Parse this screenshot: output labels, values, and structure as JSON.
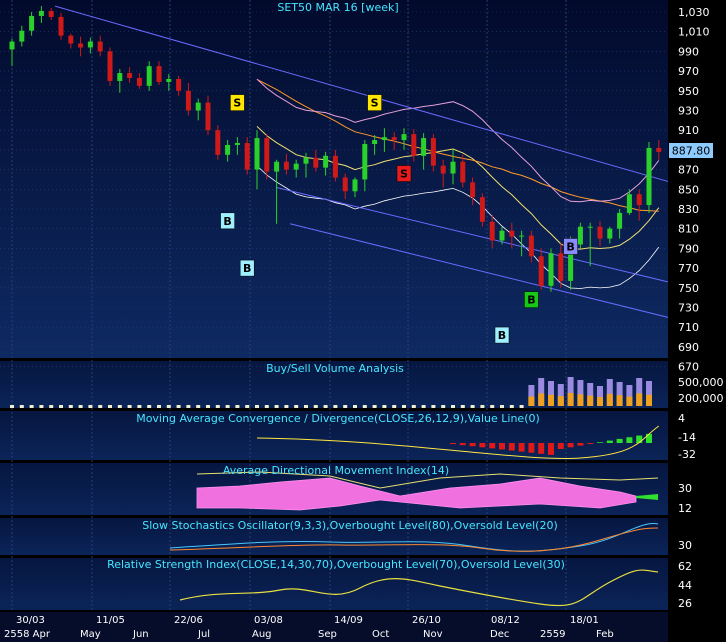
{
  "chart_data": [
    {
      "type": "candlestick",
      "title": "SET50 MAR 16",
      "interval": "[week]",
      "last_price_tag": "887.80",
      "y_ticks": [
        "1,030",
        "1,010",
        "990",
        "970",
        "950",
        "930",
        "910",
        "890",
        "870",
        "850",
        "830",
        "810",
        "790",
        "770",
        "750",
        "730",
        "710",
        "690",
        "670"
      ],
      "ylim": [
        660,
        1040
      ],
      "candles": [
        {
          "o": 992,
          "h": 1003,
          "l": 975,
          "c": 1000
        },
        {
          "o": 1000,
          "h": 1016,
          "l": 995,
          "c": 1011
        },
        {
          "o": 1011,
          "h": 1030,
          "l": 1006,
          "c": 1026
        },
        {
          "o": 1026,
          "h": 1036,
          "l": 1019,
          "c": 1031
        },
        {
          "o": 1031,
          "h": 1034,
          "l": 1022,
          "c": 1025
        },
        {
          "o": 1025,
          "h": 1029,
          "l": 1002,
          "c": 1006
        },
        {
          "o": 1006,
          "h": 1008,
          "l": 993,
          "c": 998
        },
        {
          "o": 998,
          "h": 1005,
          "l": 985,
          "c": 994
        },
        {
          "o": 994,
          "h": 1004,
          "l": 988,
          "c": 1000
        },
        {
          "o": 1000,
          "h": 1006,
          "l": 985,
          "c": 990
        },
        {
          "o": 990,
          "h": 994,
          "l": 955,
          "c": 960
        },
        {
          "o": 960,
          "h": 972,
          "l": 948,
          "c": 968
        },
        {
          "o": 968,
          "h": 974,
          "l": 958,
          "c": 963
        },
        {
          "o": 963,
          "h": 968,
          "l": 952,
          "c": 955
        },
        {
          "o": 955,
          "h": 980,
          "l": 950,
          "c": 975
        },
        {
          "o": 975,
          "h": 980,
          "l": 956,
          "c": 959
        },
        {
          "o": 959,
          "h": 967,
          "l": 950,
          "c": 962
        },
        {
          "o": 962,
          "h": 965,
          "l": 945,
          "c": 950
        },
        {
          "o": 950,
          "h": 958,
          "l": 925,
          "c": 930
        },
        {
          "o": 930,
          "h": 942,
          "l": 920,
          "c": 938
        },
        {
          "o": 938,
          "h": 945,
          "l": 905,
          "c": 910
        },
        {
          "o": 910,
          "h": 915,
          "l": 880,
          "c": 885
        },
        {
          "o": 885,
          "h": 900,
          "l": 878,
          "c": 895
        },
        {
          "o": 895,
          "h": 903,
          "l": 885,
          "c": 897
        },
        {
          "o": 897,
          "h": 903,
          "l": 865,
          "c": 870
        },
        {
          "o": 870,
          "h": 910,
          "l": 850,
          "c": 902
        },
        {
          "o": 902,
          "h": 906,
          "l": 860,
          "c": 868
        },
        {
          "o": 868,
          "h": 880,
          "l": 815,
          "c": 878
        },
        {
          "o": 878,
          "h": 886,
          "l": 865,
          "c": 870
        },
        {
          "o": 870,
          "h": 880,
          "l": 862,
          "c": 876
        },
        {
          "o": 876,
          "h": 887,
          "l": 862,
          "c": 882
        },
        {
          "o": 882,
          "h": 890,
          "l": 868,
          "c": 872
        },
        {
          "o": 872,
          "h": 888,
          "l": 864,
          "c": 884
        },
        {
          "o": 884,
          "h": 890,
          "l": 858,
          "c": 862
        },
        {
          "o": 862,
          "h": 866,
          "l": 840,
          "c": 848
        },
        {
          "o": 848,
          "h": 862,
          "l": 842,
          "c": 860
        },
        {
          "o": 860,
          "h": 900,
          "l": 848,
          "c": 896
        },
        {
          "o": 896,
          "h": 905,
          "l": 885,
          "c": 900
        },
        {
          "o": 900,
          "h": 912,
          "l": 888,
          "c": 903
        },
        {
          "o": 903,
          "h": 908,
          "l": 890,
          "c": 900
        },
        {
          "o": 900,
          "h": 912,
          "l": 890,
          "c": 906
        },
        {
          "o": 906,
          "h": 911,
          "l": 878,
          "c": 884
        },
        {
          "o": 884,
          "h": 907,
          "l": 870,
          "c": 902
        },
        {
          "o": 902,
          "h": 906,
          "l": 868,
          "c": 874
        },
        {
          "o": 874,
          "h": 880,
          "l": 852,
          "c": 866
        },
        {
          "o": 866,
          "h": 890,
          "l": 855,
          "c": 878
        },
        {
          "o": 878,
          "h": 885,
          "l": 852,
          "c": 857
        },
        {
          "o": 857,
          "h": 862,
          "l": 834,
          "c": 842
        },
        {
          "o": 842,
          "h": 846,
          "l": 812,
          "c": 817
        },
        {
          "o": 817,
          "h": 824,
          "l": 790,
          "c": 798
        },
        {
          "o": 798,
          "h": 812,
          "l": 794,
          "c": 808
        },
        {
          "o": 808,
          "h": 816,
          "l": 790,
          "c": 802
        },
        {
          "o": 802,
          "h": 808,
          "l": 782,
          "c": 803
        },
        {
          "o": 803,
          "h": 808,
          "l": 776,
          "c": 782
        },
        {
          "o": 782,
          "h": 790,
          "l": 748,
          "c": 752
        },
        {
          "o": 752,
          "h": 790,
          "l": 746,
          "c": 785
        },
        {
          "o": 785,
          "h": 795,
          "l": 750,
          "c": 757
        },
        {
          "o": 757,
          "h": 802,
          "l": 748,
          "c": 794
        },
        {
          "o": 794,
          "h": 816,
          "l": 790,
          "c": 812
        },
        {
          "o": 812,
          "h": 816,
          "l": 772,
          "c": 812
        },
        {
          "o": 812,
          "h": 818,
          "l": 792,
          "c": 800
        },
        {
          "o": 800,
          "h": 812,
          "l": 795,
          "c": 810
        },
        {
          "o": 810,
          "h": 830,
          "l": 800,
          "c": 826
        },
        {
          "o": 826,
          "h": 850,
          "l": 824,
          "c": 845
        },
        {
          "o": 845,
          "h": 850,
          "l": 818,
          "c": 834
        },
        {
          "o": 834,
          "h": 898,
          "l": 826,
          "c": 892
        },
        {
          "o": 892,
          "h": 900,
          "l": 880,
          "c": 888
        }
      ],
      "signals": [
        {
          "label": "S",
          "kind": "sell",
          "i": 23,
          "price": 938
        },
        {
          "label": "B",
          "kind": "buy",
          "i": 22,
          "price": 818
        },
        {
          "label": "B",
          "kind": "buy",
          "i": 24,
          "price": 770
        },
        {
          "label": "S",
          "kind": "sell",
          "i": 37,
          "price": 938
        },
        {
          "label": "S",
          "kind": "sell",
          "i": 40,
          "price": 866
        },
        {
          "label": "B",
          "kind": "buy",
          "i": 50,
          "price": 702
        },
        {
          "label": "B",
          "kind": "buy",
          "i": 53,
          "price": 738
        },
        {
          "label": "B",
          "kind": "buy",
          "i": 57,
          "price": 792
        }
      ],
      "x_labels_top": [
        "30/03",
        "11/05",
        "22/06",
        "03/08",
        "14/09",
        "26/10",
        "08/12",
        "18/01"
      ],
      "x_labels_bottom": [
        "2558 Apr",
        "May",
        "Jun",
        "Jul",
        "Aug",
        "Sep",
        "Oct",
        "Nov",
        "Dec",
        "2559",
        "Feb"
      ]
    },
    {
      "type": "bar",
      "title": "Buy/Sell Volume Analysis",
      "y_ticks": [
        "500,000",
        "200,000"
      ]
    },
    {
      "type": "line",
      "title": "Moving Average Convergence / Divergence(CLOSE,26,12,9),Value Line(0)",
      "y_ticks": [
        "4",
        "-14",
        "-32"
      ]
    },
    {
      "type": "area",
      "title": "Average Directional Movement Index(14)",
      "y_ticks": [
        "30",
        "12"
      ]
    },
    {
      "type": "line",
      "title": "Slow Stochastics Oscillator(9,3,3),Overbought Level(80),Oversold Level(20)",
      "y_ticks": [
        "30"
      ]
    },
    {
      "type": "line",
      "title": "Relative Strength Index(CLOSE,14,30,70),Overbought Level(70),Oversold Level(30)",
      "y_ticks": [
        "62",
        "44",
        "26"
      ]
    }
  ],
  "colors": {
    "up": "#2bd12b",
    "down": "#d01a1a",
    "grid": "#283c78",
    "trend": "#6a6aff",
    "axis_text": "#ffffff",
    "title_text": "#46e6ff",
    "price_tag": "#8ccaff"
  }
}
